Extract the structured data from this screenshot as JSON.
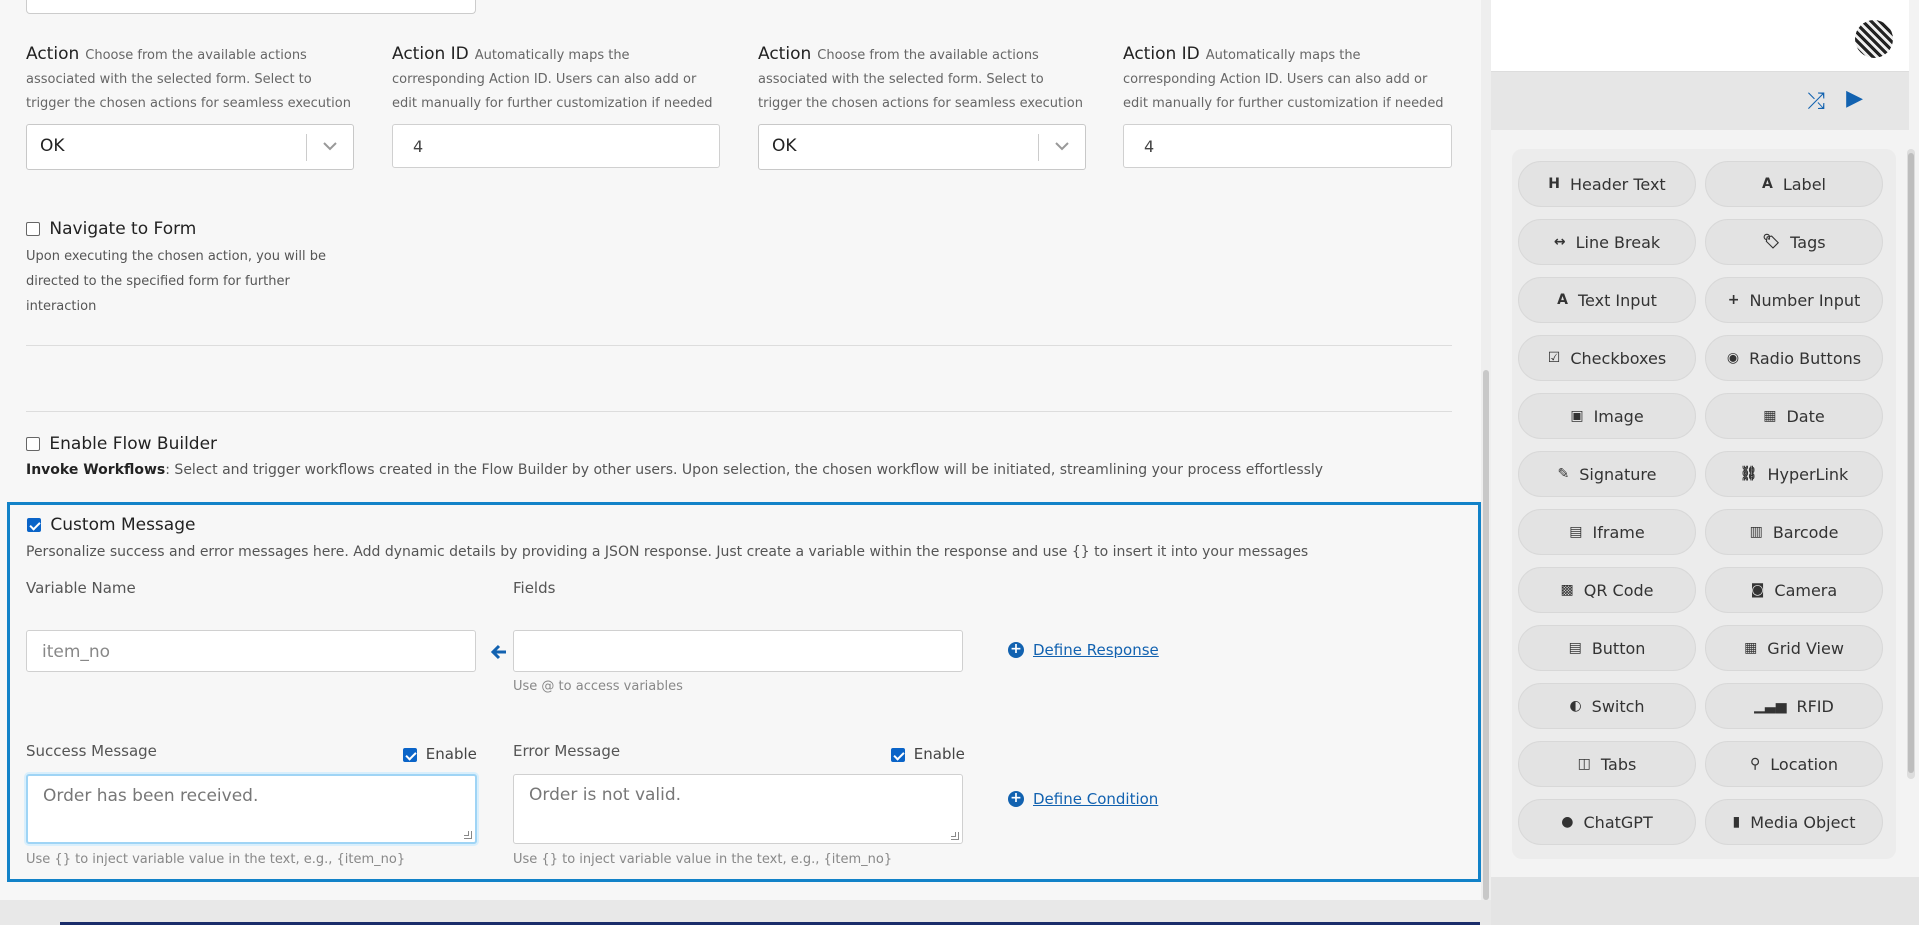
{
  "actions": [
    {
      "action_title": "Action",
      "action_desc": "Choose from the available actions associated with the selected form. Select to trigger the chosen actions for seamless execution",
      "action_value": "OK",
      "id_title": "Action ID",
      "id_desc": "Automatically maps the corresponding Action ID. Users can also add or edit manually for further customization if needed",
      "id_value": "4"
    },
    {
      "action_title": "Action",
      "action_desc": "Choose from the available actions associated with the selected form. Select to trigger the chosen actions for seamless execution",
      "action_value": "OK",
      "id_title": "Action ID",
      "id_desc": "Automatically maps the corresponding Action ID. Users can also add or edit manually for further customization if needed",
      "id_value": "4"
    }
  ],
  "navigate": {
    "label": "Navigate to Form",
    "desc": "Upon executing the chosen action, you will be directed to the specified form for further interaction"
  },
  "flow": {
    "label": "Enable Flow Builder",
    "desc_bold": "Invoke Workflows",
    "desc": ": Select and trigger workflows created in the Flow Builder by other users. Upon selection, the chosen workflow will be initiated, streamlining your process effortlessly"
  },
  "custom_message": {
    "label": "Custom Message",
    "desc": "Personalize success and error messages here. Add dynamic details by providing a JSON response. Just create a variable within the response and use {} to insert it into your messages",
    "variable_label": "Variable Name",
    "variable_placeholder": "item_no",
    "fields_label": "Fields",
    "fields_hint": "Use @ to access variables",
    "define_response": "Define Response",
    "success_label": "Success Message",
    "success_enable": "Enable",
    "success_placeholder": "Order has been received.",
    "success_hint": "Use {} to inject variable value in the text, e.g., {item_no}",
    "error_label": "Error Message",
    "error_enable": "Enable",
    "error_placeholder": "Order is not valid.",
    "error_hint": "Use {} to inject variable value in the text, e.g., {item_no}",
    "define_condition": "Define Condition"
  },
  "toolbar": {
    "shuffle_icon": "shuffle-icon",
    "play_icon": "play-icon"
  },
  "palette": [
    {
      "label": "Header Text",
      "icon": "H"
    },
    {
      "label": "Label",
      "icon": "A"
    },
    {
      "label": "Line Break",
      "icon": "↔"
    },
    {
      "label": "Tags",
      "icon": "🏷"
    },
    {
      "label": "Text Input",
      "icon": "A"
    },
    {
      "label": "Number Input",
      "icon": "+"
    },
    {
      "label": "Checkboxes",
      "icon": "☑"
    },
    {
      "label": "Radio Buttons",
      "icon": "◉"
    },
    {
      "label": "Image",
      "icon": "▣"
    },
    {
      "label": "Date",
      "icon": "▦"
    },
    {
      "label": "Signature",
      "icon": "✎"
    },
    {
      "label": "HyperLink",
      "icon": "⛓"
    },
    {
      "label": "Iframe",
      "icon": "▤"
    },
    {
      "label": "Barcode",
      "icon": "▥"
    },
    {
      "label": "QR Code",
      "icon": "▩"
    },
    {
      "label": "Camera",
      "icon": "◙"
    },
    {
      "label": "Button",
      "icon": "▤"
    },
    {
      "label": "Grid View",
      "icon": "▦"
    },
    {
      "label": "Switch",
      "icon": "◐"
    },
    {
      "label": "RFID",
      "icon": "▁▃▅"
    },
    {
      "label": "Tabs",
      "icon": "◫"
    },
    {
      "label": "Location",
      "icon": "⚲"
    },
    {
      "label": "ChatGPT",
      "icon": "●"
    },
    {
      "label": "Media Object",
      "icon": "▮"
    }
  ],
  "colors": {
    "accent": "#1282c8",
    "link": "#1262b0",
    "checkbox": "#0a64c8"
  }
}
